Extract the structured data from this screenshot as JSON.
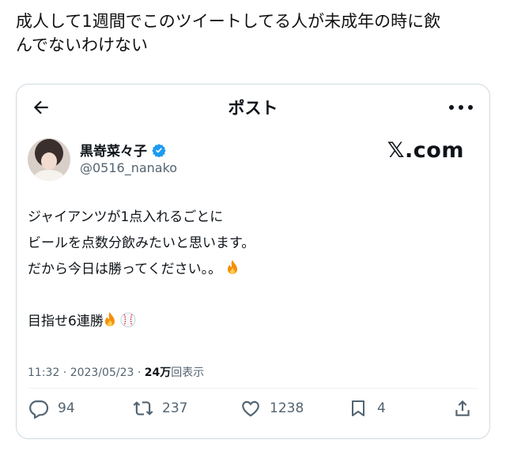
{
  "caption": {
    "line1": "成人して1週間でこのツイートしてる人が未成年の時に飲",
    "line2": "んでないわけない"
  },
  "nav": {
    "title": "ポスト"
  },
  "author": {
    "name": "黒嵜菜々子",
    "handle": "@0516_nanako"
  },
  "brand": {
    "logo": "𝕏.com"
  },
  "tweet": {
    "lines": [
      "ジャイアンツが1点入れるごとに",
      "ビールを点数分飲みたいと思います。",
      "だから今日は勝ってください。。",
      "",
      "目指せ6連勝"
    ]
  },
  "meta": {
    "time_date": "11:32 · 2023/05/23 · ",
    "views": "24万",
    "views_label": "回表示"
  },
  "actions": {
    "replies": "94",
    "reposts": "237",
    "likes": "1238",
    "bookmarks": "4"
  },
  "colors": {
    "accent": "#1d9bf0",
    "muted": "#536471",
    "text": "#0f1419"
  }
}
